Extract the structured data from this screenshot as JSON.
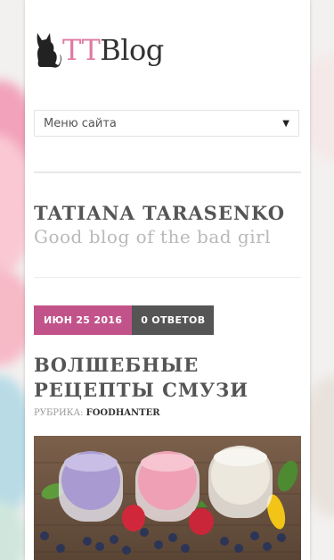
{
  "logo": {
    "part_a": "TT",
    "part_b": "Blog"
  },
  "menu": {
    "label": "Меню сайта"
  },
  "site": {
    "title": "TATIANA TARASENKO",
    "description": "Good blog of the bad girl"
  },
  "post": {
    "date": "ИЮН 25 2016",
    "comments": "0 ОТВЕТОВ",
    "title": "ВОЛШЕБНЫЕ РЕЦЕПТЫ СМУЗИ",
    "category_label": "РУБРИКА:",
    "category": "FOODHANTER"
  },
  "colors": {
    "accent": "#c2538a",
    "logo_pink": "#e07aa3",
    "dark_badge": "#555555"
  },
  "icons": {
    "logo": "cat-icon",
    "menu": "chevron-down-icon"
  }
}
